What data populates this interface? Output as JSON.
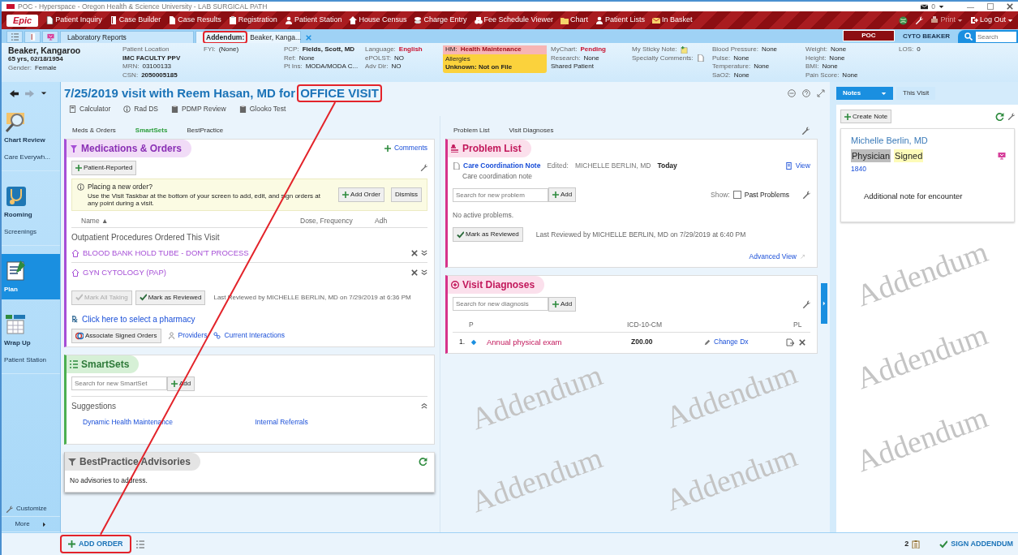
{
  "window": {
    "title": "POC - Hyperspace - Oregon Health & Science University - LAB SURGICAL PATH",
    "mail_count": "0"
  },
  "menu": {
    "logo": "Epic",
    "items": [
      "Patient Inquiry",
      "Case Builder",
      "Case Results",
      "Registration",
      "Patient Station",
      "House Census",
      "Charge Entry",
      "Fee Schedule Viewer",
      "Chart",
      "Patient Lists",
      "In Basket"
    ],
    "right": [
      {
        "label": "Print",
        "disabled": true
      },
      {
        "label": "Log Out",
        "disabled": false
      }
    ]
  },
  "tabs": [
    {
      "label": "Laboratory Reports",
      "selected": false
    },
    {
      "prefix": "Addendum:",
      "label": "Beaker, Kanga...",
      "selected": true,
      "highlighted": true
    }
  ],
  "environment": "POC",
  "user": "CYTO BEAKER",
  "search": {
    "placeholder": "Search"
  },
  "patient_header": {
    "columns": [
      [
        {
          "kind": "name",
          "value": "Beaker, Kangaroo"
        },
        {
          "kind": "bold",
          "value": "65 yrs, 02/18/1954"
        },
        {
          "kind": "field",
          "label": "Gender:",
          "value": "Female",
          "bold": false,
          "alert": false
        }
      ],
      [
        {
          "kind": "label",
          "value": "Patient Location"
        },
        {
          "kind": "bold",
          "value": "IMC FACULTY PPV"
        },
        {
          "kind": "field",
          "label": "MRN:",
          "value": "03100133",
          "bold": false,
          "alert": false
        },
        {
          "kind": "field",
          "label": "CSN:",
          "value": "2050005185",
          "bold": true,
          "alert": false
        }
      ],
      [
        {
          "kind": "field",
          "label": "FYI:",
          "value": "(None)",
          "bold": false,
          "alert": false
        }
      ],
      [
        {
          "kind": "field",
          "label": "PCP:",
          "value": "Fields, Scott, MD",
          "bold": true,
          "alert": false
        },
        {
          "kind": "field",
          "label": "Ref:",
          "value": "None",
          "bold": false,
          "alert": false
        },
        {
          "kind": "field",
          "label": "Pt Ins:",
          "value": "MODA/MODA C...",
          "bold": false,
          "alert": false
        }
      ],
      [
        {
          "kind": "field",
          "label": "Language:",
          "value": "English",
          "bold": true,
          "alert": true
        },
        {
          "kind": "field",
          "label": "ePOLST:",
          "value": "NO",
          "bold": false,
          "alert": false
        },
        {
          "kind": "field",
          "label": "Adv Dir:",
          "value": "NO",
          "bold": false,
          "alert": false
        }
      ],
      [
        {
          "kind": "pink-box",
          "label": "HM:",
          "value": "Health Maintenance"
        },
        {
          "kind": "yellow-box",
          "label": "Allergies",
          "value": "Unknown: Not on File"
        }
      ],
      [
        {
          "kind": "field",
          "label": "MyChart:",
          "value": "Pending",
          "bold": true,
          "alert": true
        },
        {
          "kind": "field",
          "label": "Research:",
          "value": "None",
          "bold": false,
          "alert": false
        },
        {
          "kind": "plain",
          "value": "Shared Patient"
        }
      ],
      [
        {
          "kind": "icon-field",
          "label": "My Sticky Note:"
        },
        {
          "kind": "icon-field",
          "label": "Specialty Comments:"
        }
      ],
      [
        {
          "kind": "field",
          "label": "Blood Pressure:",
          "value": "None",
          "bold": false,
          "alert": false
        },
        {
          "kind": "field",
          "label": "Pulse:",
          "value": "None",
          "bold": false,
          "alert": false
        },
        {
          "kind": "field",
          "label": "Temperature:",
          "value": "None",
          "bold": false,
          "alert": false
        },
        {
          "kind": "field",
          "label": "SaO2:",
          "value": "None",
          "bold": false,
          "alert": false
        }
      ],
      [
        {
          "kind": "field",
          "label": "Weight:",
          "value": "None",
          "bold": false,
          "alert": false
        },
        {
          "kind": "field",
          "label": "Height:",
          "value": "None",
          "bold": false,
          "alert": false
        },
        {
          "kind": "field",
          "label": "BMI:",
          "value": "None",
          "bold": false,
          "alert": false
        },
        {
          "kind": "field",
          "label": "Pain Score:",
          "value": "None",
          "bold": false,
          "alert": false
        }
      ],
      [
        {
          "kind": "field",
          "label": "LOS:",
          "value": "0",
          "bold": false,
          "alert": false
        }
      ]
    ]
  },
  "sidebar": {
    "items": [
      {
        "kind": "big",
        "label": "Chart Review",
        "selected": false
      },
      {
        "kind": "small",
        "label": "Care Everywh...",
        "selected": false
      },
      {
        "kind": "big",
        "label": "Rooming",
        "selected": false
      },
      {
        "kind": "small",
        "label": "Screenings",
        "selected": false
      },
      {
        "kind": "big",
        "label": "Plan",
        "selected": true
      },
      {
        "kind": "big",
        "label": "Wrap Up",
        "selected": false
      },
      {
        "kind": "small",
        "label": "Patient Station",
        "selected": false
      }
    ],
    "footer": [
      "Customize",
      "More"
    ]
  },
  "visit": {
    "title": "7/25/2019 visit with Reem Hasan, MD for",
    "type": "OFFICE VISIT",
    "type_highlighted": true,
    "tools": [
      "Calculator",
      "Rad DS",
      "PDMP Review",
      "Glooko Test"
    ]
  },
  "left_nav": [
    {
      "label": "Meds & Orders",
      "selected": false
    },
    {
      "label": "SmartSets",
      "selected": true
    },
    {
      "label": "BestPractice",
      "selected": false
    }
  ],
  "right_nav": [
    {
      "label": "Problem List",
      "selected": false
    },
    {
      "label": "Visit Diagnoses",
      "selected": false
    }
  ],
  "meds_orders": {
    "title": "Medications & Orders",
    "comments": "Comments",
    "patient_reported": "Patient-Reported",
    "info": {
      "title": "Placing a new order?",
      "text": "Use the Visit Taskbar at the bottom of your screen to add, edit, and sign orders at any point during a visit.",
      "buttons": [
        "Add Order",
        "Dismiss"
      ]
    },
    "columns": [
      "Name ▲",
      "Dose, Frequency",
      "Adh"
    ],
    "group": "Outpatient Procedures Ordered This Visit",
    "orders": [
      "BLOOD BANK HOLD TUBE - DON'T PROCESS",
      "GYN CYTOLOGY (PAP)"
    ],
    "actions": [
      {
        "label": "Mark All Taking",
        "disabled": true
      },
      {
        "label": "Mark as Reviewed",
        "disabled": false
      }
    ],
    "last_reviewed": "Last Reviewed by MICHELLE BERLIN, MD on 7/29/2019 at 6:36 PM",
    "pharmacy": "Click here to select a pharmacy",
    "associate": "Associate Signed Orders",
    "links": [
      "Providers",
      "Current Interactions"
    ]
  },
  "smartsets": {
    "title": "SmartSets",
    "search_placeholder": "Search for new SmartSet",
    "add": "Add",
    "suggestions_title": "Suggestions",
    "suggestions": [
      "Dynamic Health Maintenance",
      "Internal Referrals"
    ]
  },
  "bpa": {
    "title": "BestPractice Advisories",
    "message": "No advisories to address."
  },
  "problem_list": {
    "title": "Problem List",
    "note": {
      "link": "Care Coordination Note",
      "edited_label": "Edited:",
      "editor": "MICHELLE BERLIN, MD",
      "when": "Today",
      "description": "Care coordination note",
      "view": "View"
    },
    "search_placeholder": "Search for new problem",
    "add": "Add",
    "show_label": "Show:",
    "past_problems": {
      "label": "Past Problems",
      "checked": false
    },
    "message": "No active problems.",
    "mark_reviewed": "Mark as Reviewed",
    "last_reviewed": "Last Reviewed by MICHELLE BERLIN, MD on 7/29/2019 at 6:40 PM",
    "advanced": "Advanced View"
  },
  "visit_diagnoses": {
    "title": "Visit Diagnoses",
    "search_placeholder": "Search for new diagnosis",
    "add": "Add",
    "columns": [
      "P",
      "ICD-10-CM",
      "PL"
    ],
    "rows": [
      {
        "number": "1.",
        "name": "Annual physical exam",
        "code": "Z00.00",
        "action": "Change Dx"
      }
    ]
  },
  "notes_panel": {
    "tabs": [
      {
        "label": "Notes",
        "selected": true
      },
      {
        "label": "This Visit",
        "selected": false
      }
    ],
    "create": "Create Note",
    "notes": [
      {
        "author": "Michelle Berlin, MD",
        "role": "Physician",
        "status": "Signed",
        "time": "1840",
        "text": "Additional note for encounter"
      }
    ]
  },
  "taskbar": {
    "add_order": "ADD ORDER",
    "add_order_highlighted": true,
    "count": "2",
    "sign": "SIGN ADDENDUM"
  },
  "watermarks": [
    "Addendum",
    "Addendum",
    "Addendum",
    "Addendum",
    "Addendum",
    "Addendum",
    "Addendum"
  ],
  "annotations": [
    {
      "kind": "line"
    }
  ]
}
